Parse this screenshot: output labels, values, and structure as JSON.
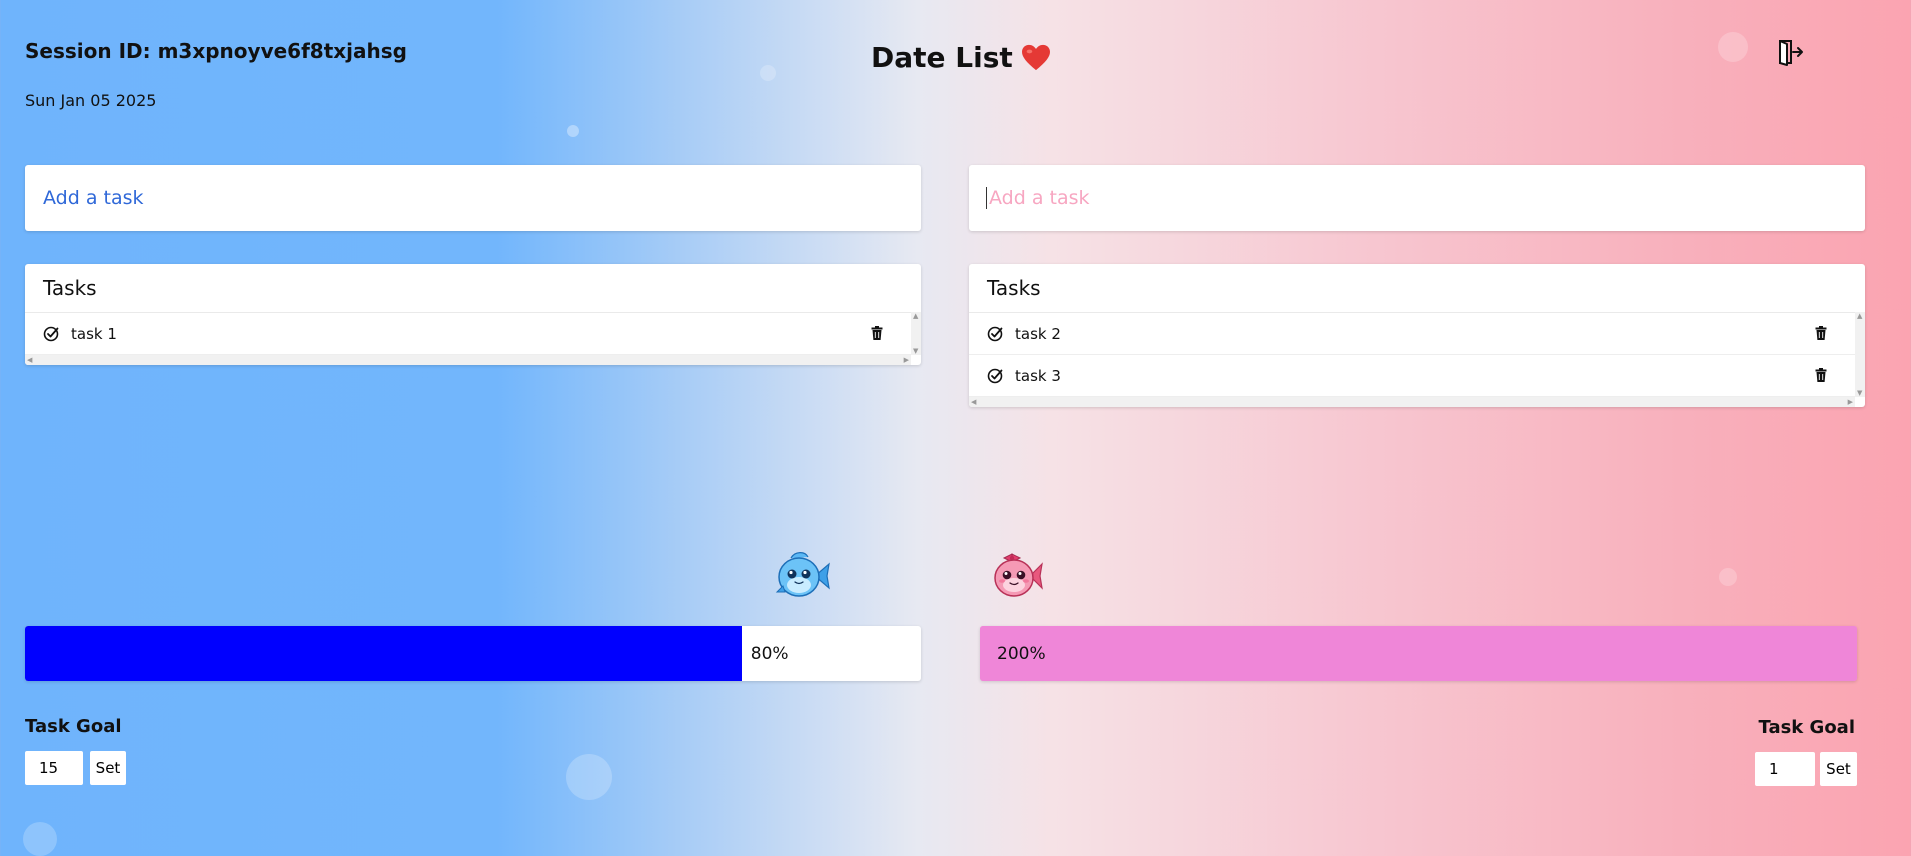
{
  "header": {
    "session_label": "Session ID: m3xpnoyve6f8txjahsg",
    "date": "Sun Jan 05 2025",
    "title": "Date List"
  },
  "left": {
    "input_placeholder": "Add a task",
    "tasks_heading": "Tasks",
    "tasks": [
      {
        "label": "task 1"
      }
    ],
    "progress": {
      "fraction": 0.8,
      "label": "80%"
    },
    "goal": {
      "label": "Task Goal",
      "value": "15",
      "button": "Set"
    }
  },
  "right": {
    "input_placeholder": "Add a task",
    "tasks_heading": "Tasks",
    "tasks": [
      {
        "label": "task 2"
      },
      {
        "label": "task 3"
      }
    ],
    "progress": {
      "fraction": 1.0,
      "label": "200%"
    },
    "goal": {
      "label": "Task Goal",
      "value": "1",
      "button": "Set"
    }
  },
  "colors": {
    "left_progress_fill": "#0000ff",
    "right_progress_fill": "#ef86d8",
    "left_placeholder": "#2f68d8",
    "right_placeholder": "#f7a6c1",
    "heart": "#e53935"
  },
  "icons": {
    "heart": "heart-icon",
    "exit": "exit-door-icon",
    "check": "check-circle-icon",
    "trash": "trash-icon",
    "blue_fish": "blue-fish-mascot",
    "pink_fish": "pink-fish-mascot"
  }
}
